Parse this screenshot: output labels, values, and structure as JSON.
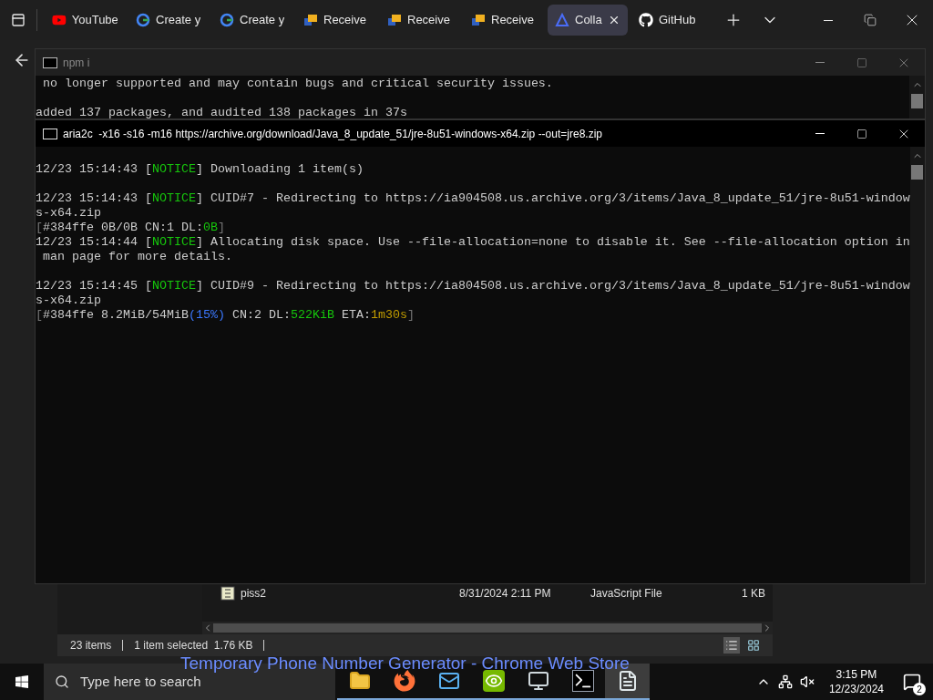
{
  "browser": {
    "tabs": [
      {
        "label": "YouTube",
        "kind": "play",
        "selected": false
      },
      {
        "label": "Create y",
        "kind": "g",
        "selected": false
      },
      {
        "label": "Create y",
        "kind": "g",
        "selected": false
      },
      {
        "label": "Receive",
        "kind": "flag",
        "selected": false
      },
      {
        "label": "Receive",
        "kind": "flag",
        "selected": false
      },
      {
        "label": "Receive",
        "kind": "flag",
        "selected": false
      },
      {
        "label": "Colla",
        "kind": "tri",
        "selected": true
      },
      {
        "label": "GitHub",
        "kind": "cat",
        "selected": false
      }
    ]
  },
  "npm_window": {
    "title": "npm i",
    "blocks": [
      [
        " no longer supported and may contain bugs and critical security issues."
      ],
      [
        "added 137 packages, and audited 138 packages in 37s"
      ]
    ]
  },
  "aria_window": {
    "title": "aria2c  -x16 -s16 -m16 https://archive.org/download/Java_8_update_51/jre-8u51-windows-x64.zip --out=jre8.zip",
    "blocks": [
      [
        [
          {
            "t": "12/23 15:14:43 [",
            "color": "#cccccc"
          },
          {
            "t": "NOTICE",
            "color": "#16c60c"
          },
          {
            "t": "] Downloading 1 item(s)",
            "color": "#cccccc"
          }
        ]
      ],
      [
        [
          {
            "t": "12/23 15:14:43 [",
            "color": "#cccccc"
          },
          {
            "t": "NOTICE",
            "color": "#16c60c"
          },
          {
            "t": "] CUID#7 - Redirecting to https://ia904508.us.archive.org/3/items/Java_8_update_51/jre-8u51-window",
            "color": "#cccccc"
          }
        ],
        [
          {
            "t": "s-x64.zip",
            "color": "#cccccc"
          }
        ],
        [
          {
            "t": "[",
            "color": "#767676"
          },
          {
            "t": "#384ffe 0B/0B CN:1 DL:",
            "color": "#cccccc"
          },
          {
            "t": "0B",
            "color": "#16c60c"
          },
          {
            "t": "]",
            "color": "#767676"
          }
        ],
        [
          {
            "t": "12/23 15:14:44 [",
            "color": "#cccccc"
          },
          {
            "t": "NOTICE",
            "color": "#16c60c"
          },
          {
            "t": "] Allocating disk space. Use --file-allocation=none to disable it. See --file-allocation option in",
            "color": "#cccccc"
          }
        ],
        [
          {
            "t": " man page for more details.",
            "color": "#cccccc"
          }
        ]
      ],
      [
        [
          {
            "t": "12/23 15:14:45 [",
            "color": "#cccccc"
          },
          {
            "t": "NOTICE",
            "color": "#16c60c"
          },
          {
            "t": "] CUID#9 - Redirecting to https://ia804508.us.archive.org/3/items/Java_8_update_51/jre-8u51-window",
            "color": "#cccccc"
          }
        ],
        [
          {
            "t": "s-x64.zip",
            "color": "#cccccc"
          }
        ],
        [
          {
            "t": "[",
            "color": "#767676"
          },
          {
            "t": "#384ffe 8.2MiB/54MiB",
            "color": "#cccccc"
          },
          {
            "t": "(15%)",
            "color": "#3b78ff"
          },
          {
            "t": " CN:2 DL:",
            "color": "#cccccc"
          },
          {
            "t": "522KiB",
            "color": "#16c60c"
          },
          {
            "t": " ETA:",
            "color": "#cccccc"
          },
          {
            "t": "1m30s",
            "color": "#c19c00"
          },
          {
            "t": "]",
            "color": "#767676"
          }
        ]
      ]
    ]
  },
  "explorer": {
    "rows": [
      {
        "name": "piss2",
        "date": "8/31/2024 2:11 PM",
        "type": "JavaScript File",
        "size": "1 KB"
      }
    ],
    "status": {
      "items": "23 items",
      "selection": "1 item selected  1.76 KB"
    }
  },
  "page_text": "Temporary Phone Number Generator - Chrome Web Store",
  "taskbar": {
    "search": {
      "placeholder": "Type here to search"
    },
    "apps": [
      {
        "kind": "folder",
        "selected": false
      },
      {
        "kind": "browser",
        "selected": false
      },
      {
        "kind": "mail",
        "selected": false
      },
      {
        "kind": "eye",
        "selected": false
      },
      {
        "kind": "pcs",
        "selected": false
      },
      {
        "kind": "terminal",
        "selected": false
      },
      {
        "kind": "notepad",
        "selected": true
      }
    ],
    "time": "3:15 PM",
    "date": "12/23/2024",
    "notifications": "2"
  }
}
